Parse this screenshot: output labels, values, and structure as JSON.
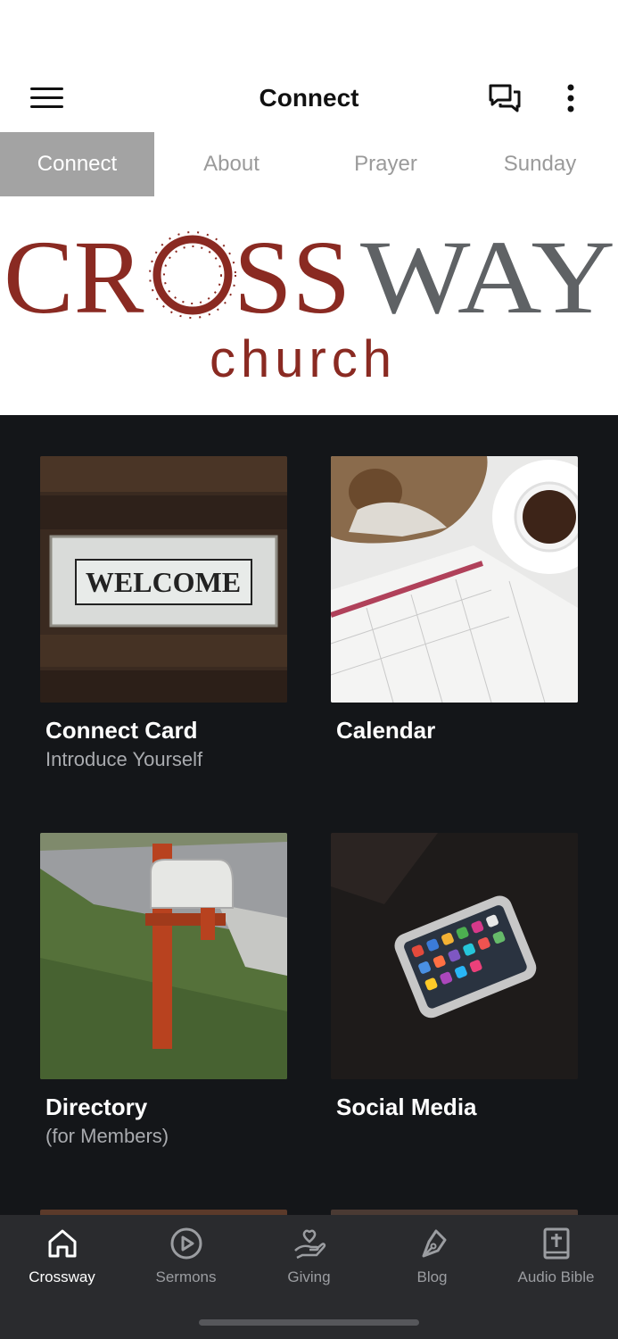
{
  "header": {
    "title": "Connect",
    "menu_icon": "hamburger-menu-icon",
    "chat_icon": "chat-bubbles-icon",
    "more_icon": "more-vertical-icon"
  },
  "tabs": [
    {
      "label": "Connect",
      "active": true
    },
    {
      "label": "About",
      "active": false
    },
    {
      "label": "Prayer",
      "active": false
    },
    {
      "label": "Sunday",
      "active": false
    }
  ],
  "logo": {
    "word_part1": "CR",
    "word_part2": "SS",
    "word_part3": "WAY",
    "subtitle": "church",
    "primary_color": "#8a2a22",
    "secondary_color": "#5f6265"
  },
  "cards": [
    {
      "title": "Connect Card",
      "subtitle": "Introduce Yourself",
      "image": "welcome-sign-image",
      "image_text": "WELCOME"
    },
    {
      "title": "Calendar",
      "subtitle": "",
      "image": "calendar-coffee-image"
    },
    {
      "title": "Directory",
      "subtitle": "(for Members)",
      "image": "mailbox-image"
    },
    {
      "title": "Social Media",
      "subtitle": "",
      "image": "smartphone-image"
    }
  ],
  "bottom_nav": [
    {
      "label": "Crossway",
      "icon": "home-icon",
      "active": true
    },
    {
      "label": "Sermons",
      "icon": "play-circle-icon",
      "active": false
    },
    {
      "label": "Giving",
      "icon": "giving-hand-icon",
      "active": false
    },
    {
      "label": "Blog",
      "icon": "pen-nib-icon",
      "active": false
    },
    {
      "label": "Audio Bible",
      "icon": "bible-icon",
      "active": false
    }
  ],
  "colors": {
    "accent_dark": "#141619",
    "nav_bg": "#2a2b2e",
    "tab_active_bg": "#a3a3a3"
  }
}
